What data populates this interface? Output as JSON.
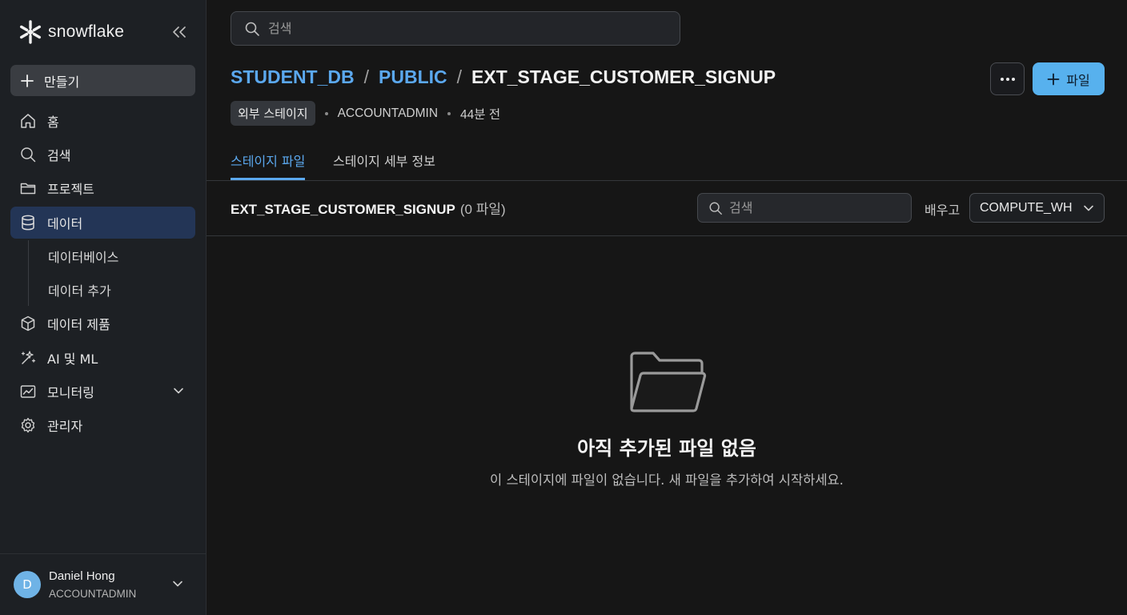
{
  "brand": {
    "name": "snowflake"
  },
  "sidebar": {
    "create_label": "만들기",
    "items": [
      {
        "label": "홈",
        "icon": "home-icon"
      },
      {
        "label": "검색",
        "icon": "search-icon"
      },
      {
        "label": "프로젝트",
        "icon": "folder-icon"
      },
      {
        "label": "데이터",
        "icon": "database-icon",
        "active": true
      },
      {
        "label": "데이터 제품",
        "icon": "cube-icon"
      },
      {
        "label": "AI 및 ML",
        "icon": "sparkle-icon"
      },
      {
        "label": "모니터링",
        "icon": "chart-icon"
      },
      {
        "label": "관리자",
        "icon": "gear-icon"
      }
    ],
    "sub_items": [
      {
        "label": "데이터베이스"
      },
      {
        "label": "데이터 추가"
      }
    ]
  },
  "user": {
    "initial": "D",
    "name": "Daniel Hong",
    "role": "ACCOUNTADMIN"
  },
  "search": {
    "placeholder": "검색"
  },
  "breadcrumb": {
    "db": "STUDENT_DB",
    "schema": "PUBLIC",
    "current": "EXT_STAGE_CUSTOMER_SIGNUP",
    "sep": "/"
  },
  "header": {
    "add_file_label": "파일"
  },
  "meta": {
    "badge": "외부 스테이지",
    "owner": "ACCOUNTADMIN",
    "updated": "44분 전"
  },
  "tabs": [
    {
      "label": "스테이지 파일",
      "active": true
    },
    {
      "label": "스테이지 세부 정보",
      "active": false
    }
  ],
  "files": {
    "stage_name": "EXT_STAGE_CUSTOMER_SIGNUP",
    "count_label": "(0 파일)",
    "search_placeholder": "검색",
    "warehouse_label": "배우고",
    "warehouse_value": "COMPUTE_WH"
  },
  "empty_state": {
    "title": "아직 추가된 파일 없음",
    "subtitle": "이 스테이지에 파일이 없습니다. 새 파일을 추가하여 시작하세요."
  },
  "colors": {
    "accent": "#5ba8ee",
    "primary_button": "#57b1ee",
    "active_nav": "#233556"
  }
}
